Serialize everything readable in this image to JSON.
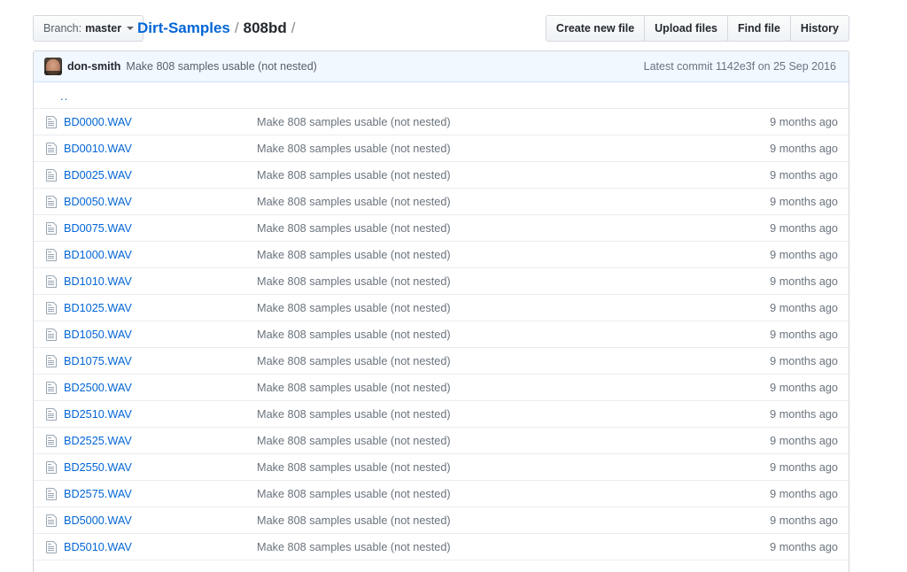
{
  "toolbar": {
    "branch": {
      "label": "Branch:",
      "value": "master"
    },
    "breadcrumb": {
      "repo": "Dirt-Samples",
      "separator": "/",
      "current": "808bd",
      "trailing": "/"
    },
    "buttons": [
      {
        "label": "Create new file"
      },
      {
        "label": "Upload files"
      },
      {
        "label": "Find file"
      },
      {
        "label": "History"
      }
    ]
  },
  "commit_header": {
    "author": "don-smith",
    "message": "Make 808 samples usable (not nested)",
    "latest_label": "Latest commit",
    "sha": "1142e3f",
    "on_label": "on",
    "date": "25 Sep 2016",
    "background_color": "#f1f8ff",
    "border_color": "#c8e1ff"
  },
  "file_list": {
    "parent_dir_label": "..",
    "file_icon": "file-text-icon",
    "link_color": "#0366d6",
    "rows": [
      {
        "name": "BD0000.WAV",
        "message": "Make 808 samples usable (not nested)",
        "age": "9 months ago"
      },
      {
        "name": "BD0010.WAV",
        "message": "Make 808 samples usable (not nested)",
        "age": "9 months ago"
      },
      {
        "name": "BD0025.WAV",
        "message": "Make 808 samples usable (not nested)",
        "age": "9 months ago"
      },
      {
        "name": "BD0050.WAV",
        "message": "Make 808 samples usable (not nested)",
        "age": "9 months ago"
      },
      {
        "name": "BD0075.WAV",
        "message": "Make 808 samples usable (not nested)",
        "age": "9 months ago"
      },
      {
        "name": "BD1000.WAV",
        "message": "Make 808 samples usable (not nested)",
        "age": "9 months ago"
      },
      {
        "name": "BD1010.WAV",
        "message": "Make 808 samples usable (not nested)",
        "age": "9 months ago"
      },
      {
        "name": "BD1025.WAV",
        "message": "Make 808 samples usable (not nested)",
        "age": "9 months ago"
      },
      {
        "name": "BD1050.WAV",
        "message": "Make 808 samples usable (not nested)",
        "age": "9 months ago"
      },
      {
        "name": "BD1075.WAV",
        "message": "Make 808 samples usable (not nested)",
        "age": "9 months ago"
      },
      {
        "name": "BD2500.WAV",
        "message": "Make 808 samples usable (not nested)",
        "age": "9 months ago"
      },
      {
        "name": "BD2510.WAV",
        "message": "Make 808 samples usable (not nested)",
        "age": "9 months ago"
      },
      {
        "name": "BD2525.WAV",
        "message": "Make 808 samples usable (not nested)",
        "age": "9 months ago"
      },
      {
        "name": "BD2550.WAV",
        "message": "Make 808 samples usable (not nested)",
        "age": "9 months ago"
      },
      {
        "name": "BD2575.WAV",
        "message": "Make 808 samples usable (not nested)",
        "age": "9 months ago"
      },
      {
        "name": "BD5000.WAV",
        "message": "Make 808 samples usable (not nested)",
        "age": "9 months ago"
      },
      {
        "name": "BD5010.WAV",
        "message": "Make 808 samples usable (not nested)",
        "age": "9 months ago"
      }
    ]
  }
}
